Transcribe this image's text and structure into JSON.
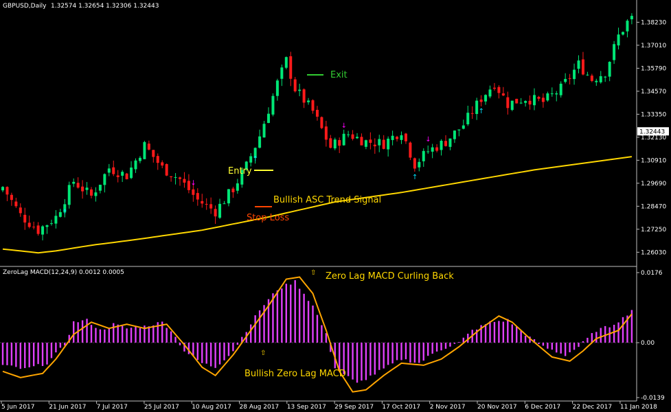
{
  "header": {
    "symbol": "GBPUSD,Daily",
    "ohlc": "1.32574 1.32654 1.32306 1.32443"
  },
  "indicator": {
    "title": "ZeroLag MACD(12,24,9) 0.0012 0.0005"
  },
  "annotations": {
    "exit": "Exit",
    "entry": "Entry",
    "signal": "Bullish ASC Trend Signal",
    "stop_loss": "Stop Loss",
    "macd_curl": "Zero Lag MACD Curling Back",
    "macd_bull": "Bullish Zero Lag MACD"
  },
  "colors": {
    "background": "#000000",
    "bull_candle": "#00e676",
    "bear_candle": "#ff1a1a",
    "ma_line": "#ffd700",
    "histogram": "#e040fb",
    "signal_line": "#ffa500",
    "axis_text": "#ffffff",
    "exit_text": "#32cd32",
    "entry_text": "#ffff33",
    "stop_text": "#ff4500",
    "macd_text": "#ffd700",
    "arrow_up": "#00e5ff",
    "arrow_down": "#ff00ff"
  },
  "chart_data": [
    {
      "type": "candlestick",
      "title": "GBPUSD,Daily",
      "ylim": [
        1.2535,
        1.389
      ],
      "yticks": [
        1.3823,
        1.3701,
        1.3579,
        1.3457,
        1.3335,
        1.3213,
        1.3091,
        1.2969,
        1.2847,
        1.2725,
        1.2603
      ],
      "ytick_labels": [
        "1.38230",
        "1.37010",
        "1.35790",
        "1.34570",
        "1.33350",
        "1.32130",
        "1.30910",
        "1.29690",
        "1.28470",
        "1.27250",
        "1.26030"
      ],
      "current_price": "1.32443",
      "x": [
        "5 Jun 2017",
        "21 Jun 2017",
        "7 Jul 2017",
        "25 Jul 2017",
        "10 Aug 2017",
        "28 Aug 2017",
        "13 Sep 2017",
        "29 Sep 2017",
        "17 Oct 2017",
        "2 Nov 2017",
        "20 Nov 2017",
        "6 Dec 2017",
        "22 Dec 2017",
        "11 Jan 2018"
      ],
      "close_anchors": [
        [
          0,
          1.295
        ],
        [
          4,
          1.28
        ],
        [
          8,
          1.272
        ],
        [
          12,
          1.279
        ],
        [
          16,
          1.298
        ],
        [
          20,
          1.29
        ],
        [
          24,
          1.305
        ],
        [
          28,
          1.301
        ],
        [
          32,
          1.317
        ],
        [
          36,
          1.305
        ],
        [
          40,
          1.299
        ],
        [
          44,
          1.288
        ],
        [
          48,
          1.282
        ],
        [
          52,
          1.294
        ],
        [
          55,
          1.306
        ],
        [
          58,
          1.322
        ],
        [
          62,
          1.35
        ],
        [
          64,
          1.362
        ],
        [
          66,
          1.347
        ],
        [
          70,
          1.335
        ],
        [
          74,
          1.316
        ],
        [
          78,
          1.323
        ],
        [
          82,
          1.319
        ],
        [
          86,
          1.318
        ],
        [
          90,
          1.325
        ],
        [
          93,
          1.307
        ],
        [
          96,
          1.314
        ],
        [
          100,
          1.319
        ],
        [
          104,
          1.328
        ],
        [
          108,
          1.342
        ],
        [
          111,
          1.35
        ],
        [
          114,
          1.339
        ],
        [
          118,
          1.342
        ],
        [
          122,
          1.34
        ],
        [
          126,
          1.347
        ],
        [
          130,
          1.36
        ],
        [
          133,
          1.352
        ],
        [
          136,
          1.356
        ],
        [
          139,
          1.375
        ],
        [
          141,
          1.3823
        ],
        [
          142,
          1.3844
        ]
      ],
      "ma_line": [
        [
          0,
          1.262
        ],
        [
          8,
          1.26
        ],
        [
          12,
          1.261
        ],
        [
          20,
          1.264
        ],
        [
          30,
          1.267
        ],
        [
          45,
          1.272
        ],
        [
          60,
          1.279
        ],
        [
          75,
          1.287
        ],
        [
          90,
          1.292
        ],
        [
          105,
          1.298
        ],
        [
          120,
          1.304
        ],
        [
          142,
          1.311
        ]
      ],
      "arrows_up": [
        14,
        57,
        93,
        108
      ],
      "arrows_down": [
        43,
        77,
        96
      ]
    },
    {
      "type": "bar",
      "title": "ZeroLag MACD(12,24,9) 0.0012 0.0005",
      "ylim": [
        -0.0139,
        0.0176
      ],
      "yticks": [
        0.0176,
        0.0,
        -0.0139
      ],
      "ytick_labels": [
        "0.0176",
        "0.00",
        "-0.0139"
      ],
      "histogram_anchors": [
        [
          0,
          -0.0055
        ],
        [
          5,
          -0.0065
        ],
        [
          10,
          -0.005
        ],
        [
          14,
          -0.0005
        ],
        [
          16,
          0.005
        ],
        [
          19,
          0.0055
        ],
        [
          22,
          0.003
        ],
        [
          25,
          0.0045
        ],
        [
          28,
          0.0035
        ],
        [
          32,
          0.004
        ],
        [
          36,
          0.005
        ],
        [
          38,
          0.003
        ],
        [
          41,
          -0.002
        ],
        [
          45,
          -0.005
        ],
        [
          48,
          -0.006
        ],
        [
          52,
          -0.002
        ],
        [
          55,
          0.003
        ],
        [
          58,
          0.008
        ],
        [
          62,
          0.013
        ],
        [
          66,
          0.015
        ],
        [
          70,
          0.009
        ],
        [
          73,
          0.002
        ],
        [
          75,
          -0.006
        ],
        [
          80,
          -0.01
        ],
        [
          85,
          -0.007
        ],
        [
          90,
          -0.004
        ],
        [
          94,
          -0.005
        ],
        [
          98,
          -0.002
        ],
        [
          103,
          0.0
        ],
        [
          106,
          0.003
        ],
        [
          110,
          0.005
        ],
        [
          114,
          0.0055
        ],
        [
          118,
          0.002
        ],
        [
          122,
          -0.001
        ],
        [
          127,
          -0.003
        ],
        [
          130,
          -0.001
        ],
        [
          134,
          0.003
        ],
        [
          137,
          0.004
        ],
        [
          140,
          0.006
        ],
        [
          142,
          0.008
        ]
      ],
      "signal_anchors": [
        [
          0,
          -0.007
        ],
        [
          4,
          -0.0085
        ],
        [
          9,
          -0.0075
        ],
        [
          12,
          -0.004
        ],
        [
          16,
          0.002
        ],
        [
          20,
          0.005
        ],
        [
          24,
          0.0035
        ],
        [
          28,
          0.0045
        ],
        [
          32,
          0.0035
        ],
        [
          37,
          0.0045
        ],
        [
          41,
          -0.0005
        ],
        [
          45,
          -0.006
        ],
        [
          48,
          -0.008
        ],
        [
          52,
          -0.003
        ],
        [
          56,
          0.003
        ],
        [
          60,
          0.009
        ],
        [
          64,
          0.0155
        ],
        [
          67,
          0.016
        ],
        [
          70,
          0.012
        ],
        [
          73,
          0.003
        ],
        [
          76,
          -0.007
        ],
        [
          79,
          -0.012
        ],
        [
          82,
          -0.0115
        ],
        [
          86,
          -0.008
        ],
        [
          90,
          -0.005
        ],
        [
          95,
          -0.0055
        ],
        [
          99,
          -0.004
        ],
        [
          103,
          -0.001
        ],
        [
          108,
          0.0035
        ],
        [
          112,
          0.0065
        ],
        [
          115,
          0.005
        ],
        [
          119,
          0.001
        ],
        [
          124,
          -0.0035
        ],
        [
          128,
          -0.0045
        ],
        [
          131,
          -0.002
        ],
        [
          134,
          0.001
        ],
        [
          139,
          0.003
        ],
        [
          142,
          0.007
        ]
      ]
    }
  ]
}
